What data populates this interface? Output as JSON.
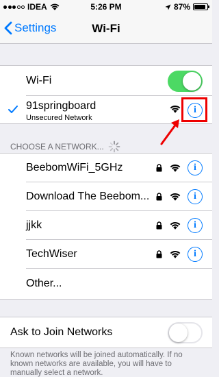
{
  "status_bar": {
    "carrier": "IDEA",
    "time": "5:26 PM",
    "battery": "87%",
    "battery_level": 0.87
  },
  "nav": {
    "back_label": "Settings",
    "title": "Wi-Fi"
  },
  "wifi_toggle": {
    "label": "Wi-Fi",
    "on": true
  },
  "connected_network": {
    "name": "91springboard",
    "subtitle": "Unsecured Network"
  },
  "section_header": "CHOOSE A NETWORK...",
  "networks": [
    {
      "name": "BeebomWiFi_5GHz",
      "locked": true
    },
    {
      "name": "Download The Beebom...",
      "locked": true
    },
    {
      "name": "jjkk",
      "locked": true
    },
    {
      "name": "TechWiser",
      "locked": true
    }
  ],
  "other_label": "Other...",
  "ask_to_join": {
    "label": "Ask to Join Networks",
    "on": false
  },
  "footer": "Known networks will be joined automatically. If no known networks are available, you will have to manually select a network.",
  "colors": {
    "accent": "#007aff",
    "toggle_on": "#4cd964",
    "annotation": "#ee0000"
  }
}
